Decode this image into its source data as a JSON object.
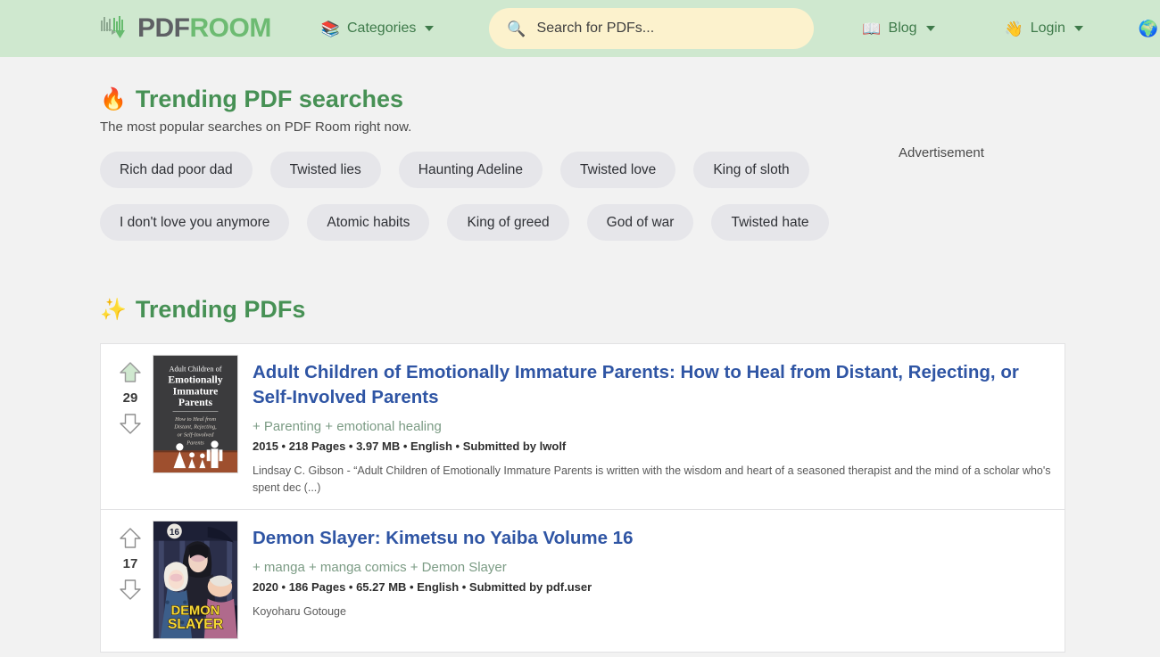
{
  "header": {
    "logo": {
      "part1": "PDF",
      "part2": "ROOM",
      "icon": "download-arrow-barcode-icon"
    },
    "categories": {
      "label": "Categories",
      "icon": "books-icon"
    },
    "search": {
      "placeholder": "Search for PDFs...",
      "value": "",
      "icon": "magnifying-glass-icon"
    },
    "blog": {
      "label": "Blog",
      "icon": "open-book-icon"
    },
    "login": {
      "label": "Login",
      "icon": "waving-hand-icon"
    },
    "language": {
      "icon": "globe-icon"
    }
  },
  "trending_searches": {
    "icon": "fire-icon",
    "title": "Trending PDF searches",
    "subtitle": "The most popular searches on PDF Room right now.",
    "chips": [
      "Rich dad poor dad",
      "Twisted lies",
      "Haunting Adeline",
      "Twisted love",
      "King of sloth",
      "I don't love you anymore",
      "Atomic habits",
      "King of greed",
      "God of war",
      "Twisted hate"
    ]
  },
  "advertisement": {
    "label": "Advertisement"
  },
  "trending_pdfs": {
    "icon": "sparkles-icon",
    "title": "Trending PDFs",
    "items": [
      {
        "votes": "29",
        "upvoted": true,
        "cover": {
          "type": "book-cover-adult-children",
          "line1": "Adult Children of",
          "line2": "Emotionally",
          "line3": "Immature",
          "line4": "Parents",
          "sub1": "How to Heal from",
          "sub2": "Distant, Rejecting,",
          "sub3": "or Self-Involved",
          "sub4": "Parents",
          "bg": "#3b3b3d",
          "floor": "#9e4f2e"
        },
        "title": "Adult Children of Emotionally Immature Parents: How to Heal from Distant, Rejecting, or Self-Involved Parents",
        "tags": "+ Parenting + emotional healing",
        "meta": "2015 • 218 Pages • 3.97 MB • English • Submitted by lwolf",
        "description": "Lindsay C. Gibson - “Adult Children of Emotionally Immature Parents is written with the wisdom and heart of a seasoned therapist and the mind of a scholar who's spent dec (...)"
      },
      {
        "votes": "17",
        "upvoted": false,
        "cover": {
          "type": "book-cover-demon-slayer",
          "badge": "16",
          "title_line1": "DEMON",
          "title_line2": "SLAYER",
          "bg": "#2b2f4a"
        },
        "title": "Demon Slayer: Kimetsu no Yaiba Volume 16",
        "tags": "+ manga + manga comics + Demon Slayer",
        "meta": "2020 • 186 Pages • 65.27 MB • English • Submitted by pdf.user",
        "description": "Koyoharu Gotouge"
      }
    ]
  },
  "colors": {
    "header_bg": "#cfe8cf",
    "page_bg": "#f2f2f2",
    "brand_green": "#479155",
    "link_blue": "#2f55a4",
    "search_bg": "#fcf2cd",
    "chip_bg": "#e6e6ea"
  }
}
